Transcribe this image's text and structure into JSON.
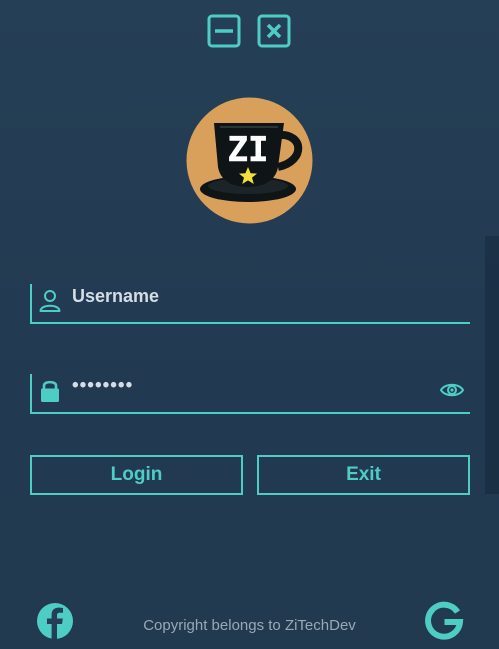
{
  "window": {
    "minimize_icon": "minimize-icon",
    "close_icon": "close-icon"
  },
  "logo": {
    "text": "ZI",
    "icon": "coffee-cup-logo",
    "colors": {
      "circle": "#d9a05b",
      "cup": "#0f1417",
      "star": "#f4e03a"
    }
  },
  "form": {
    "username": {
      "placeholder": "Username",
      "value": "",
      "icon": "user-icon"
    },
    "password": {
      "value": "12345678",
      "icon": "lock-icon",
      "toggle_icon": "eye-icon"
    },
    "login_label": "Login",
    "exit_label": "Exit"
  },
  "footer": {
    "copyright": "Copyright belongs to ZiTechDev",
    "facebook_icon": "facebook-icon",
    "google_icon": "google-icon"
  },
  "colors": {
    "accent": "#4ecdc4",
    "background": "#243e55",
    "text": "#d4dce4",
    "muted": "#9aa8b6"
  }
}
